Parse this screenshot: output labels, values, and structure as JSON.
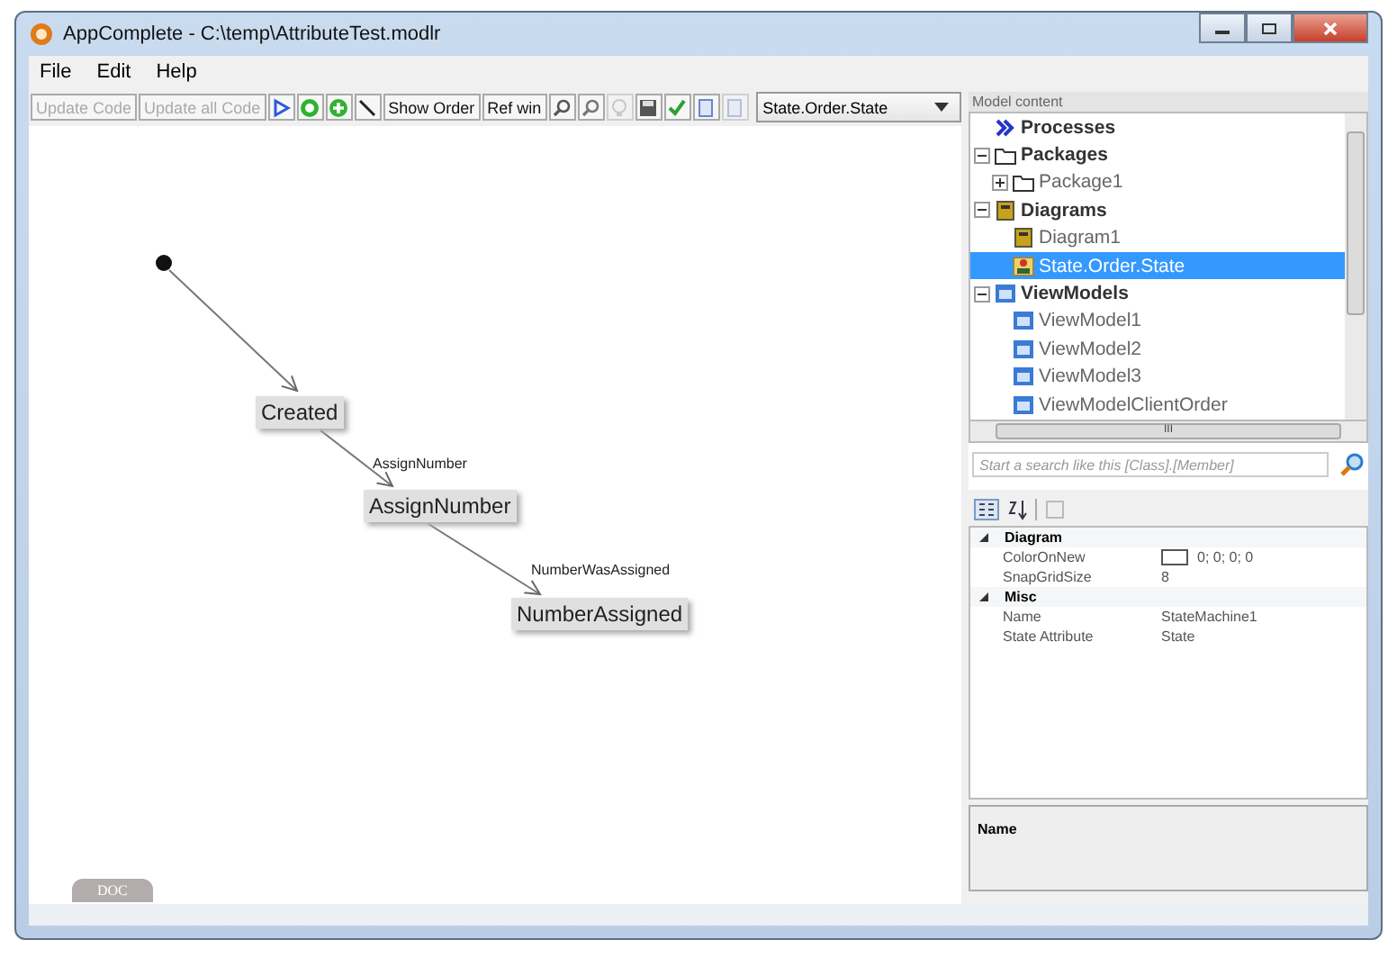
{
  "window": {
    "title": "AppComplete - C:\\temp\\AttributeTest.modlr"
  },
  "menu": [
    "File",
    "Edit",
    "Help"
  ],
  "toolbar": [
    {
      "kind": "text",
      "label": "Update Code",
      "disabled": true
    },
    {
      "kind": "text",
      "label": "Update all Code",
      "disabled": true
    },
    {
      "kind": "pointer",
      "disabled": false
    },
    {
      "kind": "ring",
      "disabled": false
    },
    {
      "kind": "plus",
      "disabled": false
    },
    {
      "kind": "line",
      "disabled": false
    },
    {
      "kind": "text",
      "label": "Show Order",
      "disabled": false
    },
    {
      "kind": "text",
      "label": "Ref win",
      "disabled": false
    },
    {
      "kind": "zoom-in",
      "disabled": false
    },
    {
      "kind": "zoom-out",
      "disabled": false
    },
    {
      "kind": "bulb",
      "disabled": true
    },
    {
      "kind": "save",
      "disabled": false
    },
    {
      "kind": "check",
      "disabled": false
    },
    {
      "kind": "page",
      "disabled": false
    },
    {
      "kind": "page",
      "disabled": true
    }
  ],
  "diagram_selector": {
    "value": "State.Order.State"
  },
  "canvas": {
    "nodes": [
      {
        "label": "Created"
      },
      {
        "label": "AssignNumber"
      },
      {
        "label": "NumberAssigned"
      }
    ],
    "transitions": [
      {
        "label": "AssignNumber"
      },
      {
        "label": "NumberWasAssigned"
      }
    ],
    "tabs": [
      {
        "label": "DOC",
        "selected": false
      }
    ]
  },
  "model_content": {
    "title": "Model content",
    "tree": [
      {
        "label": "Processes",
        "kind": "process",
        "selected": false
      },
      {
        "label": "Packages",
        "kind": "folder",
        "selected": false,
        "expanded": true,
        "children": [
          {
            "label": "Package1",
            "kind": "folder",
            "selected": false,
            "expanded": false
          }
        ]
      },
      {
        "label": "Diagrams",
        "kind": "diagram",
        "selected": false,
        "expanded": true,
        "children": [
          {
            "label": "Diagram1",
            "kind": "diagram",
            "selected": false
          },
          {
            "label": "State.Order.State",
            "kind": "state",
            "selected": true
          }
        ]
      },
      {
        "label": "ViewModels",
        "kind": "viewmodel",
        "selected": false,
        "expanded": true,
        "children": [
          {
            "label": "ViewModel1",
            "kind": "viewmodel",
            "selected": false
          },
          {
            "label": "ViewModel2",
            "kind": "viewmodel",
            "selected": false
          },
          {
            "label": "ViewModel3",
            "kind": "viewmodel",
            "selected": false
          },
          {
            "label": "ViewModelClientOrder",
            "kind": "viewmodel",
            "selected": false
          }
        ]
      }
    ],
    "scroll_thumb": "III",
    "search": {
      "placeholder": "Start a search like this [Class].[Member]"
    }
  },
  "properties": {
    "categories": [
      {
        "name": "Diagram",
        "expanded": true,
        "rows": [
          {
            "name": "ColorOnNew",
            "value": "0; 0; 0; 0",
            "kind": "color"
          },
          {
            "name": "SnapGridSize",
            "value": "8",
            "kind": "text"
          }
        ]
      },
      {
        "name": "Misc",
        "expanded": true,
        "rows": [
          {
            "name": "Name",
            "value": "StateMachine1",
            "kind": "text"
          },
          {
            "name": "State Attribute",
            "value": "State",
            "kind": "text"
          }
        ]
      }
    ],
    "description": {
      "title": "Name"
    }
  }
}
